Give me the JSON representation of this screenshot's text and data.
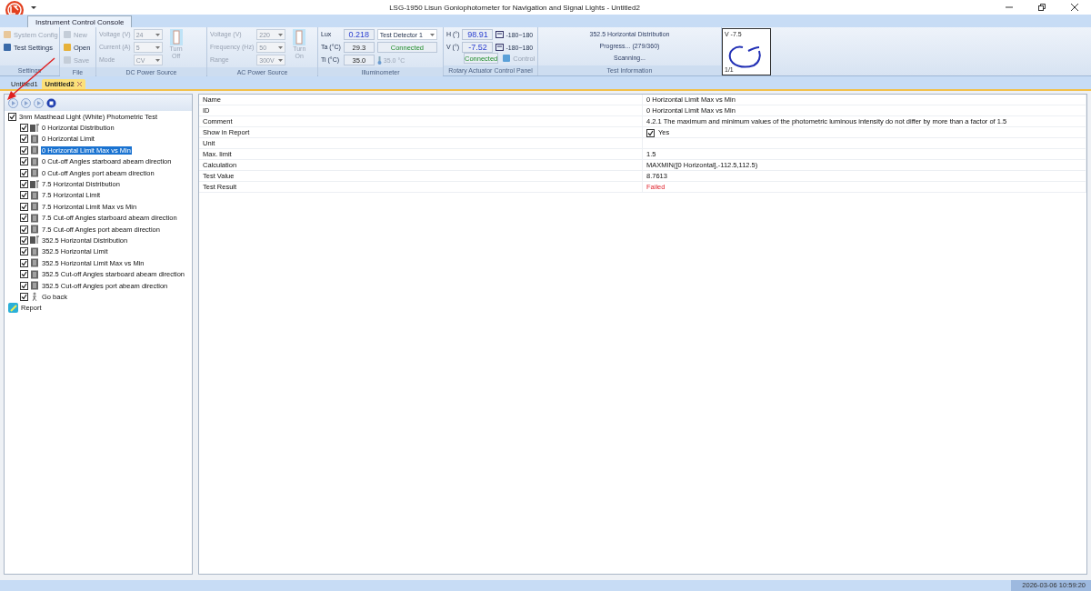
{
  "window": {
    "title": "LSG-1950 Lisun Goniophotometer for Navigation and Signal Lights - Untitled2"
  },
  "ribbon_tabs": [
    {
      "label": "Instrument Control Console",
      "selected": true
    }
  ],
  "settings": {
    "label": "Settings",
    "buttons": [
      {
        "label": "System Config",
        "disabled": true
      },
      {
        "label": "Test Settings",
        "disabled": false
      }
    ]
  },
  "file": {
    "label": "File",
    "buttons": [
      {
        "label": "New",
        "disabled": true
      },
      {
        "label": "Open",
        "disabled": false
      },
      {
        "label": "Save",
        "disabled": true
      }
    ]
  },
  "dc_power": {
    "label": "DC Power Source",
    "disabled": true,
    "fields": [
      {
        "label": "Voltage (V)",
        "value": "24"
      },
      {
        "label": "Current (A)",
        "value": "5"
      },
      {
        "label": "Mode",
        "value": "CV"
      }
    ],
    "switch": "Turn Off"
  },
  "ac_power": {
    "label": "AC Power Source",
    "disabled": true,
    "fields": [
      {
        "label": "Voltage (V)",
        "value": "220"
      },
      {
        "label": "Frequency (Hz)",
        "value": "50"
      },
      {
        "label": "Range",
        "value": "300V"
      }
    ],
    "switch": "Turn On"
  },
  "illuminometer": {
    "label": "Illuminometer",
    "readings": [
      {
        "label": "Lux",
        "value": "0.218",
        "highlight": true
      },
      {
        "label": "Ta (°C)",
        "value": "29.3",
        "highlight": false
      },
      {
        "label": "Ti (°C)",
        "value": "35.0",
        "highlight": false
      }
    ],
    "detector": "Test Detector 1",
    "status": "Connected",
    "temperature": "35.0 °C"
  },
  "rotary": {
    "label": "Rotary Actuator Control Panel",
    "axes": [
      {
        "label": "H (°)",
        "value": "98.91",
        "range": "-180~180"
      },
      {
        "label": "V (°)",
        "value": "-7.52",
        "range": "-180~180"
      }
    ],
    "status": "Connected",
    "control": {
      "label": "Control",
      "disabled": true
    }
  },
  "test_info": {
    "label": "Test Information",
    "lines": [
      "352.5 Horizontal Distribution",
      "Progress... (279/360)",
      "Scanning..."
    ]
  },
  "preview": {
    "angle": "V -7.5",
    "page": "1/1"
  },
  "doc_tabs": [
    {
      "label": "Untitled1",
      "selected": false
    },
    {
      "label": "Untitled2",
      "selected": true
    }
  ],
  "tree": {
    "label": "3nm Masthead Light (White) Photometric Test",
    "checked": true,
    "children": [
      {
        "label": "0 Horizontal Distribution",
        "checked": true,
        "kind": "distribution",
        "selected": false
      },
      {
        "label": "0 Horizontal Limit",
        "checked": true,
        "kind": "limit",
        "selected": false
      },
      {
        "label": "0 Horizontal Limit Max vs Min",
        "checked": true,
        "kind": "limit",
        "selected": true
      },
      {
        "label": "0 Cut-off Angles starboard abeam direction",
        "checked": true,
        "kind": "limit",
        "selected": false
      },
      {
        "label": "0 Cut-off Angles port abeam direction",
        "checked": true,
        "kind": "limit",
        "selected": false
      },
      {
        "label": "7.5 Horizontal Distribution",
        "checked": true,
        "kind": "distribution",
        "selected": false
      },
      {
        "label": "7.5 Horizontal Limit",
        "checked": true,
        "kind": "limit",
        "selected": false
      },
      {
        "label": "7.5 Horizontal Limit Max vs Min",
        "checked": true,
        "kind": "limit",
        "selected": false
      },
      {
        "label": "7.5 Cut-off Angles starboard abeam direction",
        "checked": true,
        "kind": "limit",
        "selected": false
      },
      {
        "label": "7.5 Cut-off Angles port abeam direction",
        "checked": true,
        "kind": "limit",
        "selected": false
      },
      {
        "label": "352.5 Horizontal Distribution",
        "checked": true,
        "kind": "distribution",
        "selected": false
      },
      {
        "label": "352.5 Horizontal Limit",
        "checked": true,
        "kind": "limit",
        "selected": false
      },
      {
        "label": "352.5 Horizontal Limit Max vs Min",
        "checked": true,
        "kind": "limit",
        "selected": false
      },
      {
        "label": "352.5 Cut-off Angles starboard abeam direction",
        "checked": true,
        "kind": "limit",
        "selected": false
      },
      {
        "label": "352.5 Cut-off Angles port abeam direction",
        "checked": true,
        "kind": "limit",
        "selected": false
      },
      {
        "label": "Go back",
        "checked": true,
        "kind": "back",
        "selected": false
      }
    ]
  },
  "report": {
    "label": "Report"
  },
  "properties": [
    {
      "name": "Name",
      "value": "0 Horizontal Limit Max vs Min",
      "kind": "text"
    },
    {
      "name": "ID",
      "value": "0 Horizontal Limit Max vs Min",
      "kind": "text"
    },
    {
      "name": "Comment",
      "value": "4.2.1 The maximum and minimum values of the photometric luminous intensity do not differ by more than a factor of 1.5",
      "kind": "text"
    },
    {
      "name": "Show in Report",
      "value": "Yes",
      "kind": "check",
      "checked": true
    },
    {
      "name": "Unit",
      "kind": "text"
    },
    {
      "name": "Max. limit",
      "value": "1.5",
      "kind": "text"
    },
    {
      "name": "Calculation",
      "value": "MAXMIN([0 Horizontal],-112.5,112.5)",
      "kind": "text"
    },
    {
      "name": "Test Value",
      "value": "8.7613",
      "kind": "text"
    },
    {
      "name": "Test Result",
      "value": "Failed",
      "kind": "result",
      "passed": false
    }
  ],
  "status_bar": {
    "time": "2026-03-06 10:59:20"
  }
}
